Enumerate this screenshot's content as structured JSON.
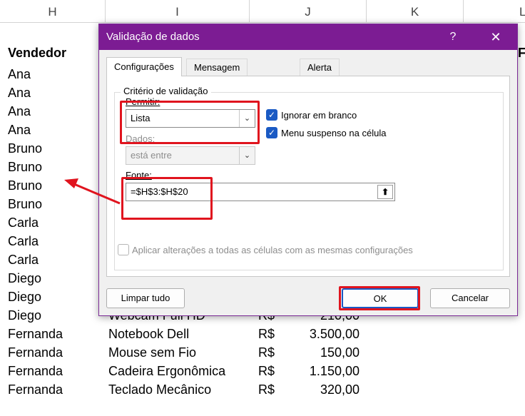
{
  "columns": [
    "H",
    "I",
    "J",
    "K",
    "L"
  ],
  "spreadsheet": {
    "header": "Vendedor",
    "col_f_partial": "F",
    "vendedores": [
      "Ana",
      "Ana",
      "Ana",
      "Ana",
      "Bruno",
      "Bruno",
      "Bruno",
      "Bruno",
      "Carla",
      "Carla",
      "Carla",
      "Diego",
      "Diego",
      "Diego",
      "Fernanda",
      "Fernanda",
      "Fernanda",
      "Fernanda"
    ],
    "visible_rows": [
      {
        "produto": "Webcam Full HD",
        "moeda": "R$",
        "valor": "210,00"
      },
      {
        "produto": "Notebook Dell",
        "moeda": "R$",
        "valor": "3.500,00"
      },
      {
        "produto": "Mouse sem Fio",
        "moeda": "R$",
        "valor": "150,00"
      },
      {
        "produto": "Cadeira Ergonômica",
        "moeda": "R$",
        "valor": "1.150,00"
      },
      {
        "produto": "Teclado Mecânico",
        "moeda": "R$",
        "valor": "320,00"
      }
    ]
  },
  "dialog": {
    "title": "Validação de dados",
    "help": "?",
    "close": "✕",
    "tabs": [
      "Configurações",
      "Mensagem de entrada",
      "Alerta de erro"
    ],
    "group_label": "Critério de validação",
    "permitir_label": "Permitir:",
    "permitir_value": "Lista",
    "dados_label": "Dados:",
    "dados_value": "está entre",
    "ignorar_label": "Ignorar em branco",
    "menu_label": "Menu suspenso na célula",
    "fonte_label": "Fonte:",
    "fonte_value": "=$H$3:$H$20",
    "aplicar_label": "Aplicar alterações a todas as células com as mesmas configurações",
    "limpar": "Limpar tudo",
    "ok": "OK",
    "cancelar": "Cancelar"
  },
  "icons": {
    "dropdown": "chevron-down-icon",
    "upload": "collapse-dialog-icon"
  },
  "colors": {
    "titlebar": "#7c1c93",
    "highlight": "#e0141e",
    "checkbox": "#1a5ac4"
  }
}
